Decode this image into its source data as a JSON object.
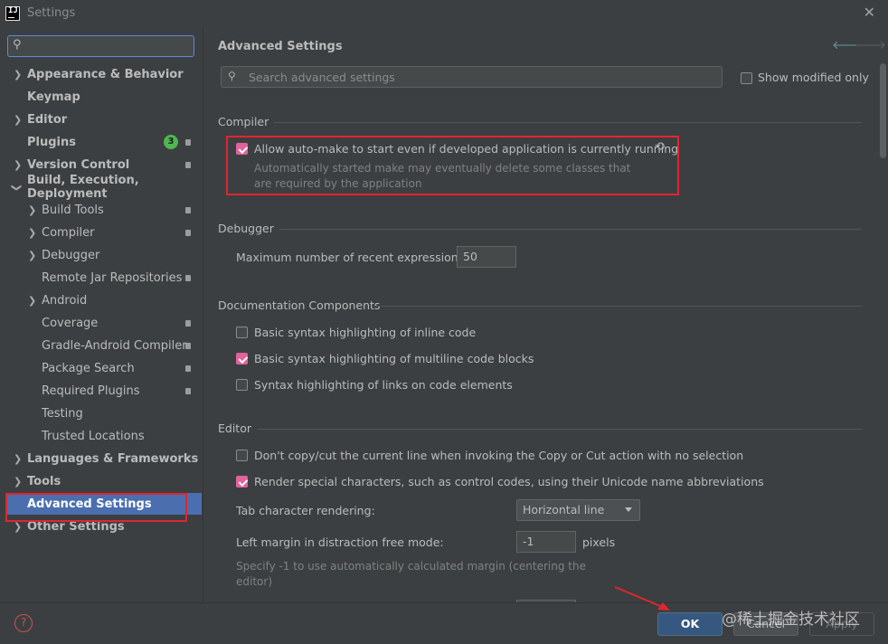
{
  "window": {
    "title": "Settings"
  },
  "sidebar": {
    "items": [
      {
        "label": "Appearance & Behavior"
      },
      {
        "label": "Keymap"
      },
      {
        "label": "Editor"
      },
      {
        "label": "Plugins",
        "badge": "3"
      },
      {
        "label": "Version Control"
      },
      {
        "label": "Build, Execution, Deployment"
      },
      {
        "label": "Build Tools"
      },
      {
        "label": "Compiler"
      },
      {
        "label": "Debugger"
      },
      {
        "label": "Remote Jar Repositories"
      },
      {
        "label": "Android"
      },
      {
        "label": "Coverage"
      },
      {
        "label": "Gradle-Android Compiler"
      },
      {
        "label": "Package Search"
      },
      {
        "label": "Required Plugins"
      },
      {
        "label": "Testing"
      },
      {
        "label": "Trusted Locations"
      },
      {
        "label": "Languages & Frameworks"
      },
      {
        "label": "Tools"
      },
      {
        "label": "Advanced Settings"
      },
      {
        "label": "Other Settings"
      }
    ]
  },
  "main": {
    "title": "Advanced Settings",
    "search_placeholder": "Search advanced settings",
    "show_modified": "Show modified only",
    "compiler": {
      "heading": "Compiler",
      "auto_make": "Allow auto-make to start even if developed application is currently running",
      "auto_make_hint_1": "Automatically started make may eventually delete some classes that",
      "auto_make_hint_2": "are required by the application"
    },
    "debugger": {
      "heading": "Debugger",
      "max_expr_label": "Maximum number of recent expressions:",
      "max_expr_value": "50"
    },
    "doc": {
      "heading": "Documentation Components",
      "inline": "Basic syntax highlighting of inline code",
      "multiline": "Basic syntax highlighting of multiline code blocks",
      "links": "Syntax highlighting of links on code elements"
    },
    "editor": {
      "heading": "Editor",
      "no_copy": "Don't copy/cut the current line when invoking the Copy or Cut action with no selection",
      "render_special": "Render special characters, such as control codes, using their Unicode name abbreviations",
      "tab_label": "Tab character rendering:",
      "tab_value": "Horizontal line",
      "margin_label": "Left margin in distraction free mode:",
      "margin_value": "-1",
      "margin_unit": "pixels",
      "margin_hint_1": "Specify -1 to use automatically calculated margin (centering the",
      "margin_hint_2": "editor)"
    }
  },
  "footer": {
    "ok": "OK",
    "cancel": "Cancel",
    "apply": "Apply"
  },
  "watermark": "@稀土掘金技术社区",
  "colors": {
    "accent": "#4b6eaf",
    "checkbox": "#e2639c",
    "highlight_box": "#e0262f"
  }
}
